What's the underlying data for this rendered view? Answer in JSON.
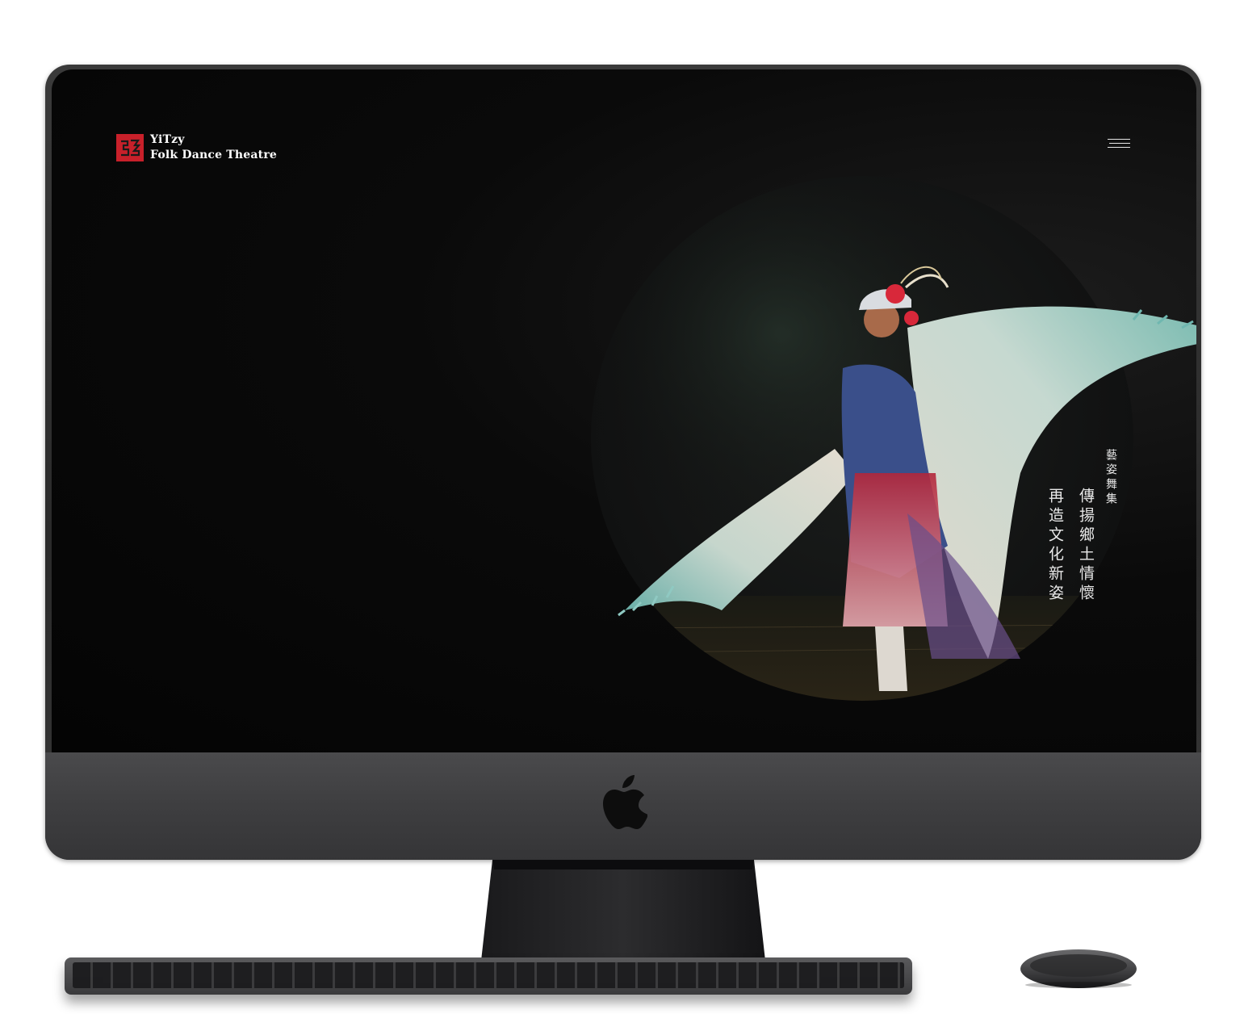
{
  "site": {
    "logo_line1": "YiTzy",
    "logo_line2": "Folk Dance Theatre",
    "logo_mark_color": "#c8202a",
    "menu_icon": "hamburger-icon"
  },
  "hero": {
    "tagline_small": "藝姿舞集",
    "tagline_line1": "傳揚鄉土情懷",
    "tagline_line2": "再造文化新姿",
    "image_subject": "dancer-with-winged-costume"
  },
  "device": {
    "type": "imac-pro-mockup",
    "accent_colors": {
      "screen": "#050505",
      "bezel": "#2e2e30",
      "chin": "#3e3e40"
    }
  }
}
